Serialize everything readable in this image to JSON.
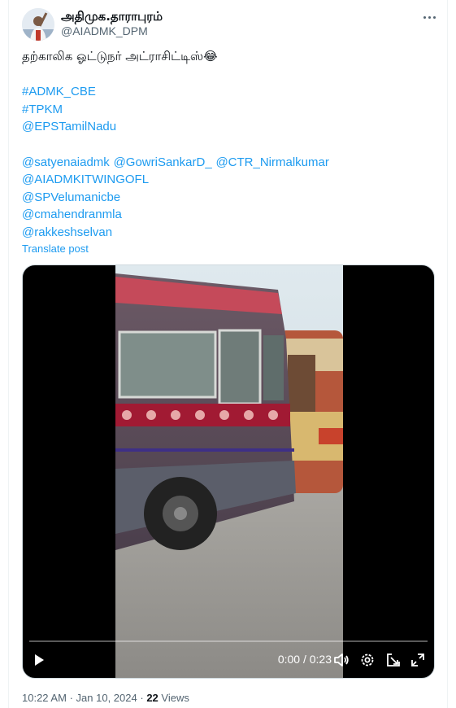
{
  "author": {
    "name": "அதிமுக.தாராபுரம்",
    "handle": "@AIADMK_DPM"
  },
  "tweet": {
    "line1": "தற்காலிக ஓட்டுநர் அட்ராசிட்டிஸ்😂",
    "hashtags": [
      "#ADMK_CBE",
      "#TPKM"
    ],
    "mention_first": "@EPSTamilNadu",
    "mentions_row": [
      "@satyenaiadmk",
      "@GowriSankarD_",
      "@CTR_Nirmalkumar"
    ],
    "mentions_more": [
      "@AIADMKITWINGOFL",
      "@SPVelumanicbe",
      "@cmahendranmla",
      "@rakkeshselvan"
    ],
    "translate_label": "Translate post"
  },
  "video": {
    "time_current": "0:00",
    "time_separator": " / ",
    "time_total": "0:23",
    "progress": 0.0,
    "icons": [
      "play-icon",
      "volume-icon",
      "settings-icon",
      "pop-out-icon",
      "fullscreen-icon"
    ]
  },
  "meta": {
    "time": "10:22 AM",
    "date": "Jan 10, 2024",
    "sep": "·",
    "views_count": "22",
    "views_label": "Views"
  },
  "colors": {
    "link": "#1d9bf0",
    "secondary_text": "#536471"
  }
}
